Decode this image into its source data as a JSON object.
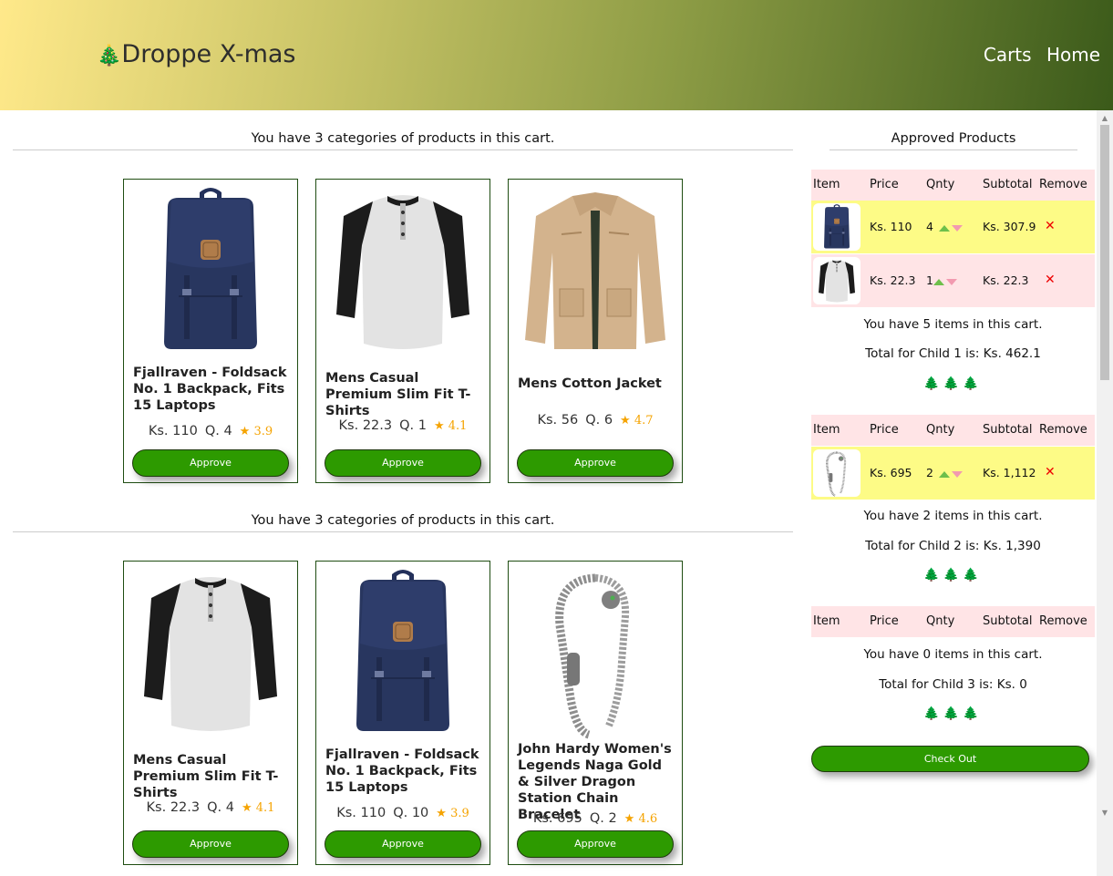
{
  "header": {
    "brand": "Droppe X-mas",
    "brand_icon": "christmas-tree-emoji",
    "nav": [
      "Carts",
      "Home"
    ]
  },
  "carts": [
    {
      "title": "You have 3 categories of products in this cart.",
      "products": [
        {
          "name": "Fjallraven - Foldsack No. 1 Backpack, Fits 15 Laptops",
          "price": "Ks. 110",
          "qty": "Q. 4",
          "rating": "3.9",
          "image": "backpack",
          "button": "Approve"
        },
        {
          "name": "Mens Casual Premium Slim Fit T-Shirts",
          "price": "Ks. 22.3",
          "qty": "Q. 1",
          "rating": "4.1",
          "image": "tshirt",
          "button": "Approve"
        },
        {
          "name": "Mens Cotton Jacket",
          "price": "Ks. 56",
          "qty": "Q. 6",
          "rating": "4.7",
          "image": "jacket",
          "button": "Approve"
        }
      ]
    },
    {
      "title": "You have 3 categories of products in this cart.",
      "products": [
        {
          "name": "Mens Casual Premium Slim Fit T-Shirts",
          "price": "Ks. 22.3",
          "qty": "Q. 4",
          "rating": "4.1",
          "image": "tshirt",
          "button": "Approve"
        },
        {
          "name": "Fjallraven - Foldsack No. 1 Backpack, Fits 15 Laptops",
          "price": "Ks. 110",
          "qty": "Q. 10",
          "rating": "3.9",
          "image": "backpack",
          "button": "Approve"
        },
        {
          "name": "John Hardy Women's Legends Naga Gold & Silver Dragon Station Chain Bracelet",
          "price": "Ks. 695",
          "qty": "Q. 2",
          "rating": "4.6",
          "image": "bracelet",
          "button": "Approve"
        }
      ]
    }
  ],
  "approved": {
    "title": "Approved Products",
    "columns": [
      "Item",
      "Price",
      "Qnty",
      "Subtotal",
      "Remove"
    ],
    "children": [
      {
        "rows": [
          {
            "image": "backpack",
            "price": "Ks. 110",
            "qty": "4",
            "subtotal": "Ks. 307.9",
            "remove": "✕"
          },
          {
            "image": "tshirt",
            "price": "Ks. 22.3",
            "qty": "1",
            "subtotal": "Ks. 22.3",
            "remove": "✕"
          }
        ],
        "items_text": "You have 5 items in this cart.",
        "total_text": "Total for Child 1 is: Ks. 462.1",
        "trees": "🌲🌲🌲"
      },
      {
        "rows": [
          {
            "image": "bracelet",
            "price": "Ks. 695",
            "qty": "2",
            "subtotal": "Ks. 1,112",
            "remove": "✕"
          }
        ],
        "items_text": "You have 2 items in this cart.",
        "total_text": "Total for Child 2 is: Ks. 1,390",
        "trees": "🌲🌲🌲"
      },
      {
        "rows": [],
        "items_text": "You have 0 items in this cart.",
        "total_text": "Total for Child 3 is: Ks. 0",
        "trees": "🌲🌲🌲"
      }
    ],
    "checkout": "Check Out"
  },
  "colors": {
    "button": "#2d9a00",
    "star": "#f5a300",
    "row_yellow": "#fdfb86",
    "row_pink": "#ffe4e6",
    "remove": "#e00000"
  }
}
